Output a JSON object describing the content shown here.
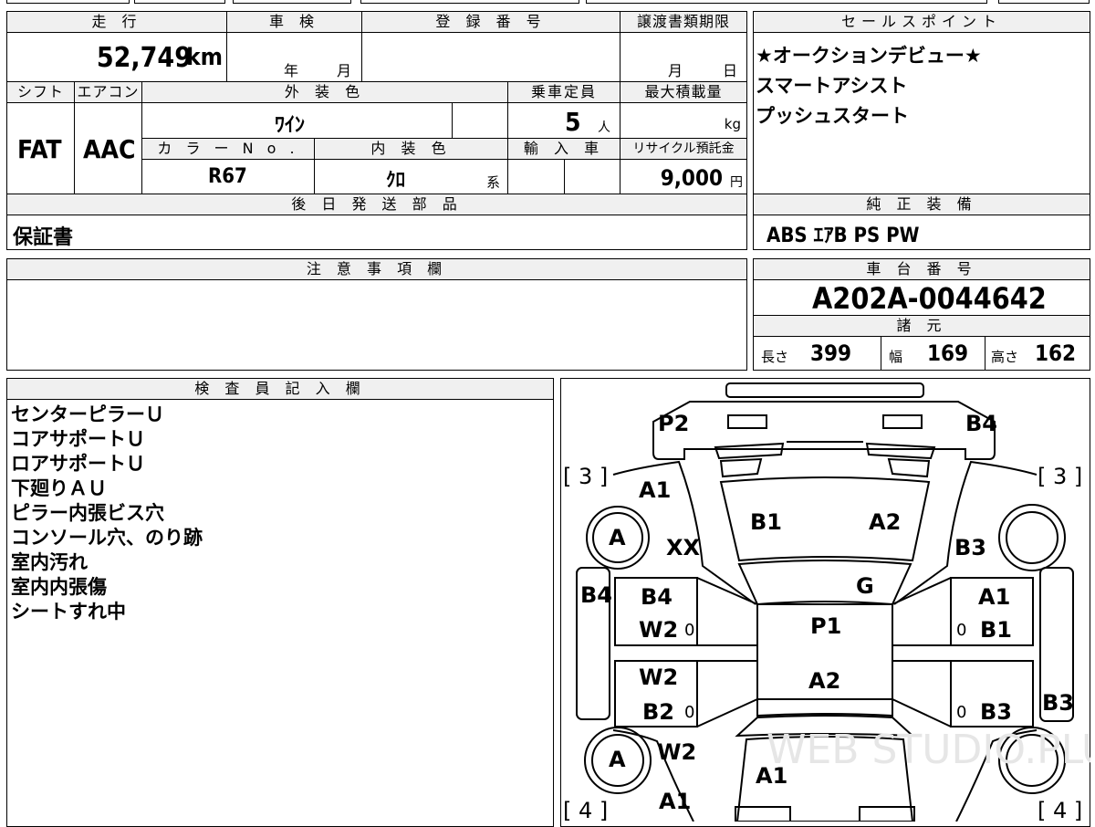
{
  "headers": {
    "mileage": "走 行",
    "shaken": "車 検",
    "registration": "登 録 番 号",
    "transfer_deadline": "譲渡書類期限",
    "sales_points": "セールスポイント",
    "shift": "シフト",
    "aircon": "エアコン",
    "exterior_color": "外 装 色",
    "capacity": "乗車定員",
    "max_load": "最大積載量",
    "color_no": "カ ラ ー N o .",
    "interior_color": "内 装 色",
    "import": "輸 入 車",
    "recycle_fee": "リサイクル預託金",
    "later_parts": "後 日 発 送 部 品",
    "standard_equipment": "純 正 装 備",
    "notes": "注 意 事 項 欄",
    "chassis_no": "車 台 番 号",
    "specs": "諸 元",
    "inspector": "検 査 員 記 入 欄"
  },
  "values": {
    "mileage": "52,749",
    "mileage_unit": "km",
    "shaken_year": "年",
    "shaken_month": "月",
    "transfer_month": "月",
    "transfer_day": "日",
    "shift": "FAT",
    "aircon": "AAC",
    "exterior_color": "ﾜｲﾝ",
    "capacity": "5",
    "capacity_unit": "人",
    "max_load_unit": "kg",
    "color_no": "R67",
    "interior_color": "ｸﾛ",
    "interior_suffix": "系",
    "recycle_fee": "9,000",
    "recycle_unit": "円",
    "later_parts": "保証書",
    "standard_equipment": "ABS ｴｱB PS PW",
    "chassis_no": "A202A-0044642"
  },
  "sales_points": [
    "★オークションデビュー★",
    "スマートアシスト",
    "プッシュスタート"
  ],
  "specs": {
    "length_label": "長さ",
    "length": "399",
    "width_label": "幅",
    "width": "169",
    "height_label": "高さ",
    "height": "162"
  },
  "inspector_notes": [
    "センターピラーＵ",
    "コアサポートＵ",
    "ロアサポートＵ",
    "下廻りＡＵ",
    "ピラー内張ビス穴",
    "コンソール穴、のり跡",
    "室内汚れ",
    "室内内張傷",
    "シートすれ中"
  ],
  "diagram": {
    "watermark": "WEB STUDIO.PLUS",
    "tire_front_left": "[ 3 ]",
    "tire_front_right": "[ 3 ]",
    "tire_rear_left": "[ 4 ]",
    "tire_rear_right": "[ 4 ]",
    "labels": {
      "p2": "P2",
      "b4_top": "B4",
      "a1_top": "A1",
      "a_fl": "A",
      "xx": "XX",
      "b1_hood": "B1",
      "a2_hood": "A2",
      "b3_right": "B3",
      "g": "G",
      "b4_left": "B4",
      "b4_door": "B4",
      "w2_fd": "W2",
      "zero_fd": "0",
      "a1_rd": "A1",
      "zero_rd": "0",
      "b1_rd": "B1",
      "p1": "P1",
      "w2_rl": "W2",
      "a2_roof": "A2",
      "b2": "B2",
      "zero_rl": "0",
      "zero_rr": "0",
      "b3_rr": "B3",
      "b3_side": "B3",
      "a_rl": "A",
      "w2_rear": "W2",
      "a1_trunk": "A1",
      "a1_bottom": "A1"
    }
  }
}
